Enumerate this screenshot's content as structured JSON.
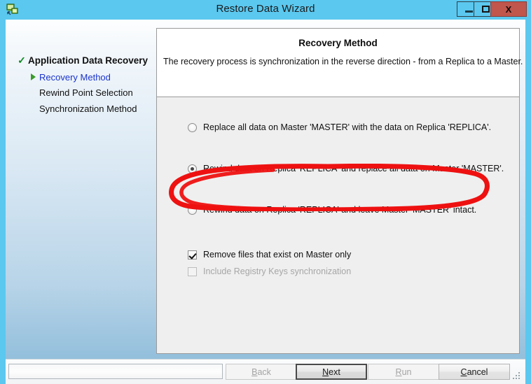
{
  "window": {
    "title": "Restore Data Wizard",
    "icon": "server-recovery-icon",
    "minimize_label": "–",
    "maximize_label": "□",
    "close_label": "X"
  },
  "sidebar": {
    "items": [
      {
        "label": "Application Data Recovery",
        "icon": "green-check-icon",
        "state": "completed",
        "level": 0
      },
      {
        "label": "Recovery Method",
        "icon": "green-arrow-icon",
        "state": "current",
        "level": 1
      },
      {
        "label": "Rewind Point Selection",
        "icon": "none",
        "state": "pending",
        "level": 1
      },
      {
        "label": "Synchronization Method",
        "icon": "none",
        "state": "pending",
        "level": 1
      }
    ]
  },
  "pane": {
    "title": "Recovery Method",
    "description": "The recovery process is synchronization in the reverse direction - from a Replica to a Master."
  },
  "options": {
    "radios": [
      {
        "label": "Replace all data on Master 'MASTER' with the data on Replica 'REPLICA'.",
        "selected": false
      },
      {
        "label": "Rewind data on Replica 'REPLICA' and replace all data on Master 'MASTER'.",
        "selected": true
      },
      {
        "label": "Rewind data on Replica 'REPLICA' and leave Master 'MASTER' intact.",
        "selected": false
      }
    ],
    "checkboxes": [
      {
        "label": "Remove files that exist on Master only",
        "checked": true,
        "disabled": false
      },
      {
        "label": "Include Registry Keys synchronization",
        "checked": false,
        "disabled": true
      }
    ]
  },
  "annotation": {
    "shape": "hand-drawn-red-ellipse",
    "color": "#ee1111",
    "targets": "radio option 2"
  },
  "footer": {
    "status_value": "",
    "buttons": [
      {
        "key": "back",
        "label": "Back",
        "accel": "B",
        "disabled": true,
        "focused": false
      },
      {
        "key": "next",
        "label": "Next",
        "accel": "N",
        "disabled": false,
        "focused": true
      },
      {
        "key": "run",
        "label": "Run",
        "accel": "R",
        "disabled": true,
        "focused": false
      },
      {
        "key": "cancel",
        "label": "Cancel",
        "accel": "C",
        "disabled": false,
        "focused": false
      }
    ],
    "resize_grip": "resize-grip-icon"
  },
  "colors": {
    "titlebar": "#5bc8ef",
    "close_button": "#c0564c",
    "accent_link": "#1b33cc",
    "check_green": "#0f8a23",
    "annotation_red": "#ee1111"
  }
}
